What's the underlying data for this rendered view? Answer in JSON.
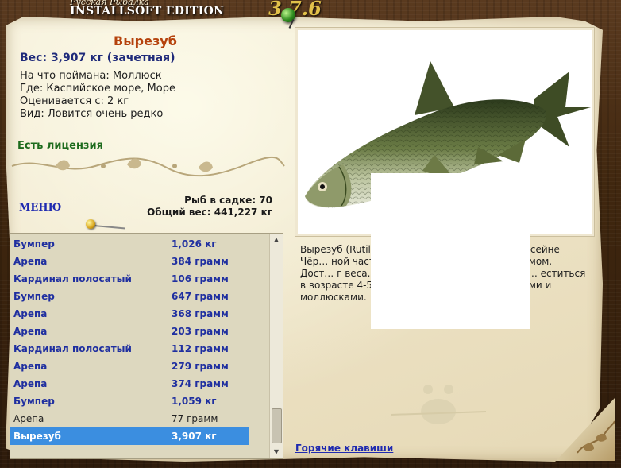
{
  "header": {
    "subtitle": "Русская Рыбалка",
    "edition": "INSTALLSOFT EDITION",
    "version": "3.7.6"
  },
  "fish": {
    "name": "Вырезуб",
    "weight_line": "Вес: 3,907 кг (зачетная)",
    "bait": "На что поймана: Моллюск",
    "location": "Где: Каспийское море, Море",
    "valued_from": "Оценивается с: 2 кг",
    "rarity": "Вид: Ловится очень редко",
    "license": "Есть лицензия",
    "description": "Вырезуб (Rutil… из семейства кар… нён в бассейне Чёр… ной части Каспийского м… идом - кутумом. Дост… г веса. Спина тёмная… серебристые, … еститься в возрасте 4-5 л… тается насекомыми, червями и моллюсками."
  },
  "nav": {
    "menu": "МЕНЮ",
    "hotkeys": "Горячие клавиши"
  },
  "stats": {
    "fish_in_keepnet": "Рыб в садке: 70",
    "total_weight": "Общий вес: 441,227 кг"
  },
  "catch_list": [
    {
      "name": "Бумпер",
      "value": "1,026 кг",
      "style": "bold"
    },
    {
      "name": "Арепа",
      "value": "384 грамм",
      "style": "bold"
    },
    {
      "name": "Кардинал полосатый",
      "value": "106 грамм",
      "style": "bold"
    },
    {
      "name": "Бумпер",
      "value": "647 грамм",
      "style": "bold"
    },
    {
      "name": "Арепа",
      "value": "368 грамм",
      "style": "bold"
    },
    {
      "name": "Арепа",
      "value": "203 грамм",
      "style": "bold"
    },
    {
      "name": "Кардинал полосатый",
      "value": "112 грамм",
      "style": "bold"
    },
    {
      "name": "Арепа",
      "value": "279 грамм",
      "style": "bold"
    },
    {
      "name": "Арепа",
      "value": "374 грамм",
      "style": "bold"
    },
    {
      "name": "Бумпер",
      "value": "1,059 кг",
      "style": "bold"
    },
    {
      "name": "Арепа",
      "value": "77 грамм",
      "style": "plain"
    },
    {
      "name": "Вырезуб",
      "value": "3,907 кг",
      "style": "selected"
    }
  ],
  "colors": {
    "fish_name": "#b5420c",
    "link": "#1f2ab0",
    "license": "#1d6b1d",
    "selection": "#3b8ee0"
  },
  "icons": {
    "pin_top": "green-pushpin-icon",
    "pin_list": "yellow-pushpin-icon",
    "scroll_up": "scroll-up-arrow-icon",
    "scroll_down": "scroll-down-arrow-icon"
  }
}
